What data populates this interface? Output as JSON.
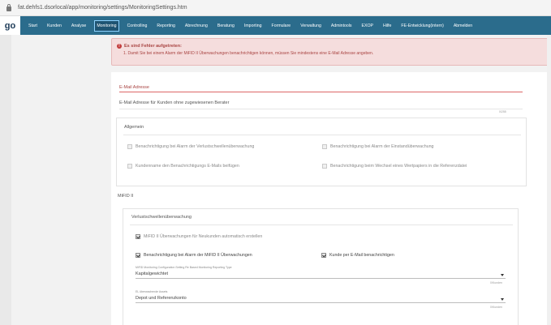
{
  "browser": {
    "url": "fat.dehfs1.dsorlocal/app/monitoring/settings/MonitoringSettings.htm"
  },
  "nav": {
    "brand": "go",
    "items": [
      "Start",
      "Kunden",
      "Analyse",
      "Monitoring",
      "Controlling",
      "Reporting",
      "Abrechnung",
      "Beratung",
      "Importing",
      "Formulare",
      "Verwaltung",
      "Admintools",
      "EXOP",
      "Hilfe",
      "FE-Entwicklung(intern)",
      "Abmelden"
    ],
    "active_index": 3
  },
  "alert": {
    "title": "Es sind Fehler aufgetreten:",
    "message": "1. Damit Sie bei einem Alarm der MiFID II Überwachungen benachrichtigen können, müssen Sie mindestens eine E-Mail Adresse angeben."
  },
  "email": {
    "label": "E-Mail Adresse",
    "help": "E-Mail Adresse für Kunden ohne zugewiesenen Berater",
    "counter_top": "0/255",
    "counter_help": "0/255"
  },
  "allgemein": {
    "title": "Allgemein",
    "options": [
      {
        "label": "Benachrichtigung bei Alarm der Verlustschwellenüberwachung",
        "checked": false
      },
      {
        "label": "Benachrichtigung bei Alarm der Einstandüberwachung",
        "checked": false
      },
      {
        "label": "Kundenname den Benachrichtigungs E-Mails beifügen",
        "checked": false
      },
      {
        "label": "Benachrichtigung beim Wechsel eines Wertpapiers in die Referenzdatei",
        "checked": false
      }
    ]
  },
  "mifid": {
    "title": "MiFID II",
    "subsection_title": "Verlustschwellenüberwachung",
    "options": [
      {
        "label": "MiFID II Überwachungen für Neukunden automatisch erstellen",
        "checked": true,
        "enabled": false
      },
      {
        "label": "Benachrichtigung bei Alarm der MiFID II Überwachungen",
        "checked": true,
        "enabled": true
      },
      {
        "label": "Kunde per E-Mail benachrichtigen",
        "checked": true,
        "enabled": true
      }
    ],
    "select1": {
      "label": "MiFID Monitoring Configuration Setting Re Based Monitoring Reporting Type",
      "value": "Kapitalgewichtet",
      "counter": "0/Kunden"
    },
    "select2": {
      "label": "EL überwachende Assets",
      "value": "Depot und Referenzkonto",
      "counter": "0/Kunden"
    }
  }
}
